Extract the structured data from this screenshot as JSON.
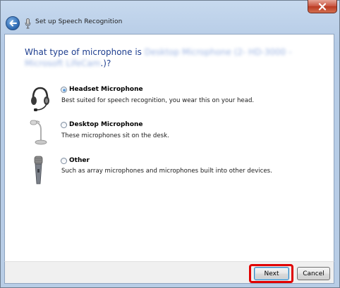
{
  "window": {
    "title": "Set up Speech Recognition",
    "close_icon": "close-icon",
    "back_icon": "back-arrow-icon"
  },
  "question": {
    "prefix": "What type of microphone is ",
    "device": "Desktop Microphone (2- HD-3000 - Microsoft LifeCam",
    "suffix": ".)?"
  },
  "options": [
    {
      "label": "Headset Microphone",
      "description": "Best suited for speech recognition, you wear this on your head.",
      "selected": true,
      "icon": "headset-icon"
    },
    {
      "label": "Desktop Microphone",
      "description": "These microphones sit on the desk.",
      "selected": false,
      "icon": "desktop-microphone-icon"
    },
    {
      "label": "Other",
      "description": "Such as array microphones and microphones built into other devices.",
      "selected": false,
      "icon": "handheld-microphone-icon"
    }
  ],
  "buttons": {
    "next": "Next",
    "cancel": "Cancel"
  },
  "colors": {
    "question_text": "#1e3e8f",
    "highlight": "#e00000"
  }
}
